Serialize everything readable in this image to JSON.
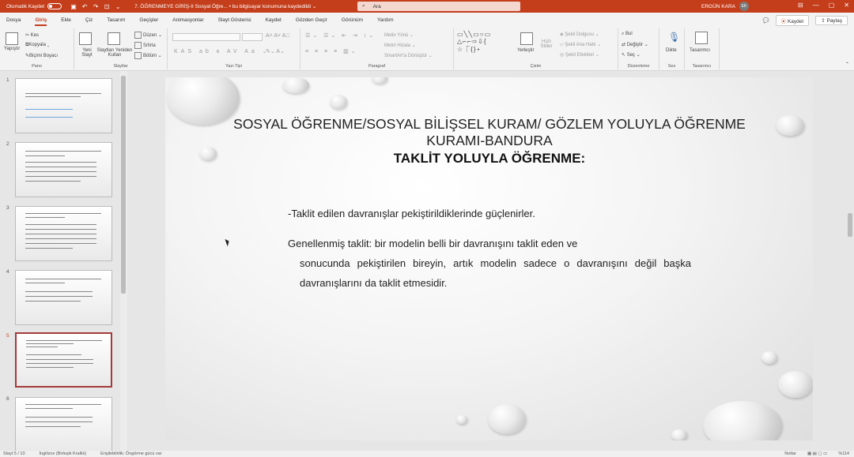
{
  "titlebar": {
    "autosave_label": "Otomatik Kaydet",
    "doc_title": "7. ÖĞRENMEYE GİRİŞ-II Sosyal Öğre... • bu bilgisayar konumuna kaydedildi ⌄",
    "search_placeholder": "Ara",
    "user_name": "ERGÜN KARA",
    "user_initials": "EK"
  },
  "menubar": {
    "tabs": [
      "Dosya",
      "Giriş",
      "Ekle",
      "Çiz",
      "Tasarım",
      "Geçişler",
      "Animasyonlar",
      "Slayt Gösterisi",
      "Kaydet",
      "Gözden Geçir",
      "Görünüm",
      "Yardım"
    ],
    "active_tab": "Giriş",
    "save_button": "Kaydet",
    "share_button": "Paylaş"
  },
  "ribbon": {
    "groups": {
      "clipboard": "Pano",
      "slides": "Slaytlar",
      "font": "Yazı Tipi",
      "paragraph": "Paragraf",
      "drawing": "Çizim",
      "editing": "Düzenleme",
      "voice": "Ses",
      "designer": "Tasarımcı"
    },
    "paste": "Yapıştır",
    "cut": "Kes",
    "copy": "Kopyala",
    "format_painter": "Biçimi Boyacı",
    "new_slide": "Yeni Slayt",
    "reuse_slides": "Slaytları Yeniden Kullan",
    "layout": "Düzen",
    "reset": "Sıfırla",
    "section": "Bölüm",
    "text_direction": "Metin Yönü",
    "align_text": "Metni Hizala",
    "smartart": "SmartArt'a Dönüştür",
    "arrange": "Yerleştir",
    "quick_styles": "Hızlı Stiller",
    "shape_fill": "Şekil Dolgusu",
    "shape_outline": "Şekil Ana Hattı",
    "shape_effects": "Şekil Efektleri",
    "find": "Bul",
    "replace": "Değiştir",
    "select": "Seç",
    "dictate": "Dikte",
    "designer": "Tasarımcı"
  },
  "thumbnails": {
    "numbers": [
      "1",
      "2",
      "3",
      "4",
      "5",
      "6"
    ],
    "active_index": 5
  },
  "slide": {
    "title": "SOSYAL ÖĞRENME/SOSYAL BİLİŞSEL KURAM/ GÖZLEM YOLUYLA ÖĞRENME KURAMI-BANDURA",
    "subtitle": "TAKLİT YOLUYLA ÖĞRENME:",
    "bullet1": "-Taklit edilen davranışlar pekiştirildiklerinde güçlenirler.",
    "bullet2_line1": "Genellenmiş taklit: bir modelin belli bir davranışını taklit eden ve",
    "bullet2_rest": "sonucunda pekiştirilen bireyin, artık modelin sadece o davranışını değil başka davranışlarını da taklit etmesidir."
  },
  "statusbar": {
    "slide_info": "Slayt 5 / 10",
    "language": "İngilizce (Birleşik Krallık)",
    "accessibility": "Erişilebilirlik: Öngörme gücü var",
    "notes": "Notlar",
    "zoom": "%114"
  },
  "colors": {
    "accent": "#c43e1c",
    "active_thumb_border": "#a33a3a"
  }
}
